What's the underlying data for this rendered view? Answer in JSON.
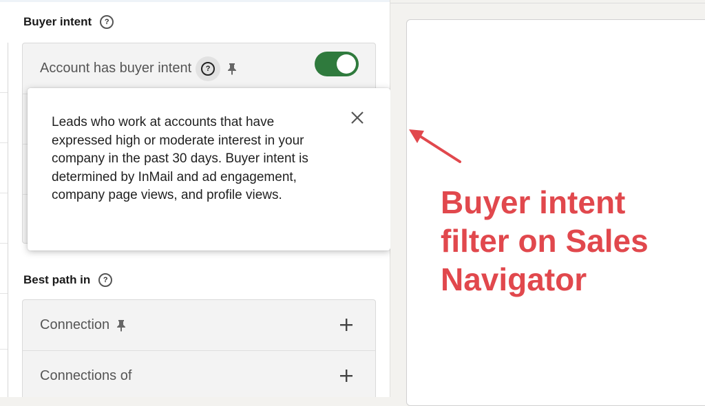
{
  "buyer_intent": {
    "title": "Buyer intent",
    "filter_label": "Account has buyer intent",
    "toggle_on": true
  },
  "tooltip": {
    "text": "Leads who work at accounts that have expressed high or moderate interest in your company in the past 30 days. Buyer intent is determined by InMail and ad engagement, company page views, and profile views."
  },
  "best_path": {
    "title": "Best path in",
    "items": [
      {
        "label": "Connection",
        "pinned": true
      },
      {
        "label": "Connections of",
        "pinned": false
      }
    ]
  },
  "annotation": {
    "text": "Buyer intent filter on Sales Navigator"
  },
  "colors": {
    "toggle_on": "#2f7a3d",
    "annotation": "#e1484d"
  },
  "icons": [
    "help-icon",
    "pin-icon",
    "plus-icon",
    "close-icon",
    "arrow-icon"
  ]
}
